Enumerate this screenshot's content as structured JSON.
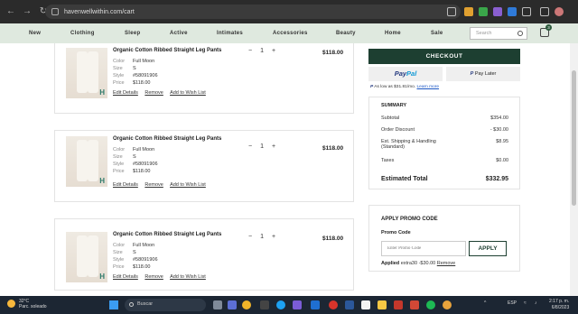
{
  "browser": {
    "url": "havenwellwithin.com/cart",
    "nav_back": "←",
    "nav_forward": "→",
    "nav_reload": "↻"
  },
  "site_nav": {
    "items": [
      "New",
      "Clothing",
      "Sleep",
      "Active",
      "Intimates",
      "Accessories",
      "Beauty",
      "Home",
      "Sale"
    ],
    "search_placeholder": "Search",
    "cart_count": "3"
  },
  "cart": {
    "items": [
      {
        "title": "Organic Cotton Ribbed Straight Leg Pants",
        "color_label": "Color",
        "color": "Full Moon",
        "size_label": "Size",
        "size": "S",
        "style_label": "Style",
        "style": "#58091906",
        "price_label": "Price",
        "price": "$118.00",
        "edit": "Edit Details",
        "remove": "Remove",
        "wishlist": "Add to Wish List",
        "qty_minus": "−",
        "qty": "1",
        "qty_plus": "+",
        "line_total": "$118.00"
      },
      {
        "title": "Organic Cotton Ribbed Straight Leg Pants",
        "color_label": "Color",
        "color": "Full Moon",
        "size_label": "Size",
        "size": "S",
        "style_label": "Style",
        "style": "#58091906",
        "price_label": "Price",
        "price": "$118.00",
        "edit": "Edit Details",
        "remove": "Remove",
        "wishlist": "Add to Wish List",
        "qty_minus": "−",
        "qty": "1",
        "qty_plus": "+",
        "line_total": "$118.00"
      },
      {
        "title": "Organic Cotton Ribbed Straight Leg Pants",
        "color_label": "Color",
        "color": "Full Moon",
        "size_label": "Size",
        "size": "S",
        "style_label": "Style",
        "style": "#58091906",
        "price_label": "Price",
        "price": "$118.00",
        "edit": "Edit Details",
        "remove": "Remove",
        "wishlist": "Add to Wish List",
        "qty_minus": "−",
        "qty": "1",
        "qty_plus": "+",
        "line_total": "$118.00"
      }
    ]
  },
  "checkout": {
    "button": "CHECKOUT",
    "paypal_a": "Pay",
    "paypal_b": "Pal",
    "pay_later": "Pay Later",
    "as_low_as": "As low as $31.81/mo.",
    "learn_more": "Learn more"
  },
  "summary": {
    "heading": "SUMMARY",
    "subtotal_label": "Subtotal",
    "subtotal": "$354.00",
    "discount_label": "Order Discount",
    "discount": "- $30.00",
    "shipping_label": "Est. Shipping & Handling",
    "shipping_note": "(Standard)",
    "shipping": "$8.95",
    "taxes_label": "Taxes",
    "taxes": "$0.00",
    "total_label": "Estimated Total",
    "total": "$332.95"
  },
  "promo": {
    "heading": "APPLY PROMO CODE",
    "label": "Promo Code",
    "placeholder": "Enter Promo Code",
    "apply": "APPLY",
    "applied_label": "Applied",
    "applied_code": "extra30 -$30.00",
    "remove": "Remove"
  },
  "taskbar": {
    "temp": "32°C",
    "condition": "Parc. soleado",
    "search": "Buscar",
    "lang": "ESP",
    "time": "2:17 p. m.",
    "date": "6/8/2023"
  },
  "colors": {
    "accent": "#1d3f31",
    "nav_bg": "#dfe9df"
  }
}
